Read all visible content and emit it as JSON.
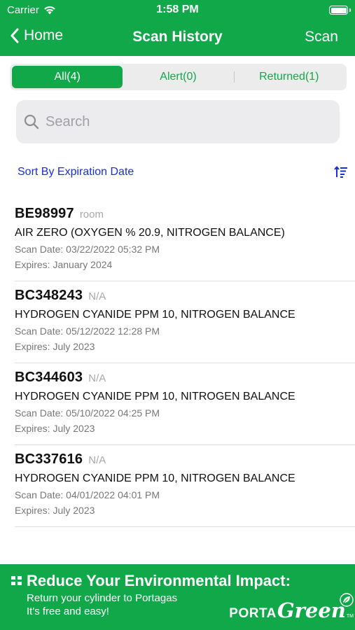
{
  "status_bar": {
    "carrier": "Carrier",
    "time": "1:58 PM"
  },
  "nav": {
    "back_label": "Home",
    "title": "Scan History",
    "action_label": "Scan"
  },
  "filters": {
    "selected": "All(4)",
    "segments": [
      {
        "label": "All(4)"
      },
      {
        "label": "Alert(0)"
      },
      {
        "label": "Returned(1)"
      }
    ]
  },
  "search": {
    "placeholder": "Search",
    "value": ""
  },
  "sort": {
    "label": "Sort By Expiration Date",
    "icon": "sort-descending-icon"
  },
  "scans": [
    {
      "code": "BE98997",
      "location": "room",
      "description": "AIR ZERO (OXYGEN % 20.9, NITROGEN BALANCE)",
      "scan_date": "Scan Date: 03/22/2022 05:32 PM",
      "expires": "Expires: January 2024"
    },
    {
      "code": "BC348243",
      "location": "N/A",
      "description": "HYDROGEN CYANIDE PPM 10, NITROGEN BALANCE",
      "scan_date": "Scan Date: 05/12/2022 12:28 PM",
      "expires": "Expires: July 2023"
    },
    {
      "code": "BC344603",
      "location": "N/A",
      "description": "HYDROGEN CYANIDE PPM 10, NITROGEN BALANCE",
      "scan_date": "Scan Date: 05/10/2022 04:25 PM",
      "expires": "Expires: July 2023"
    },
    {
      "code": "BC337616",
      "location": "N/A",
      "description": "HYDROGEN CYANIDE PPM 10, NITROGEN BALANCE",
      "scan_date": "Scan Date: 04/01/2022 04:01 PM",
      "expires": "Expires: July 2023"
    }
  ],
  "banner": {
    "headline": "Reduce Your Environmental  Impact:",
    "line1": "Return your cylinder to Portagas",
    "line2": "It's free and easy!",
    "logo_porta": "PORTA",
    "logo_green": "Green",
    "logo_tm": "TM"
  },
  "colors": {
    "brand_green": "#11a84a",
    "link_blue": "#1a2fd6",
    "muted_text": "#777777"
  }
}
